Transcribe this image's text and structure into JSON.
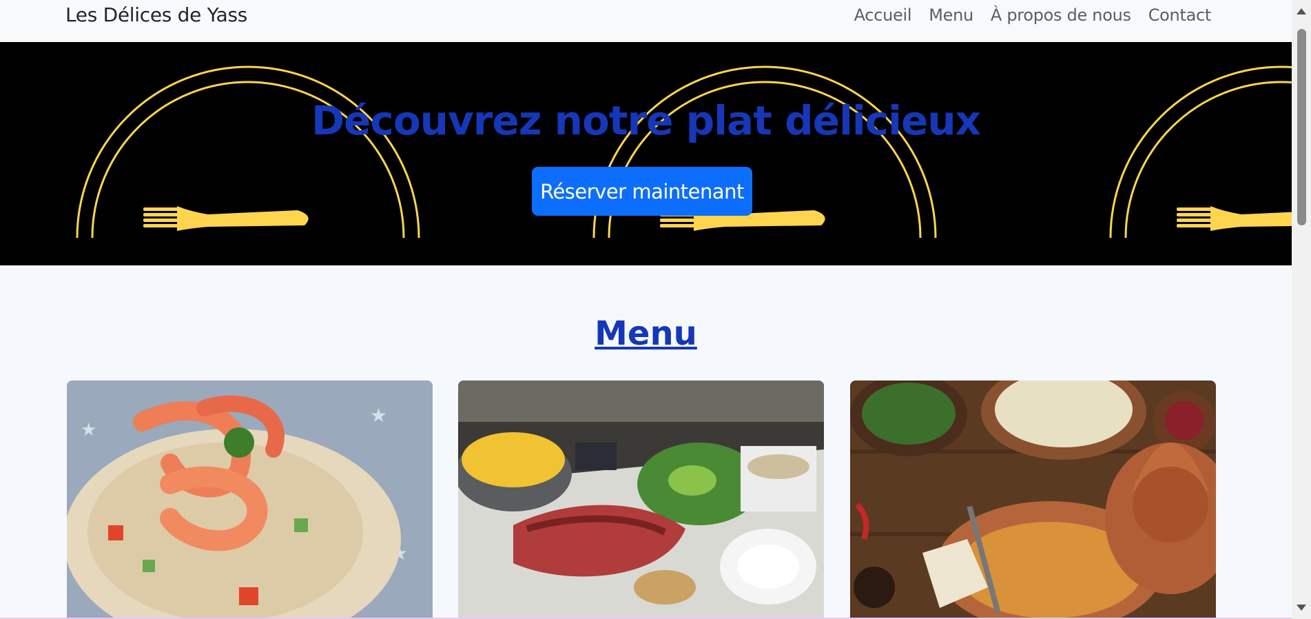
{
  "navbar": {
    "brand": "Les Délices de Yass",
    "links": [
      "Accueil",
      "Menu",
      "À propos de nous",
      "Contact"
    ]
  },
  "hero": {
    "title": "Découvrez notre plat délicieux",
    "button_label": "Réserver maintenant"
  },
  "menu": {
    "title": "Menu",
    "cards": [
      {
        "image": "shrimp-couscous-salad"
      },
      {
        "image": "steak-plate-with-fries"
      },
      {
        "image": "tagine-spread"
      }
    ]
  },
  "colors": {
    "accent_blue": "#1637b8",
    "button_blue": "#0d6efd",
    "plate_yellow": "#ffd54f"
  }
}
